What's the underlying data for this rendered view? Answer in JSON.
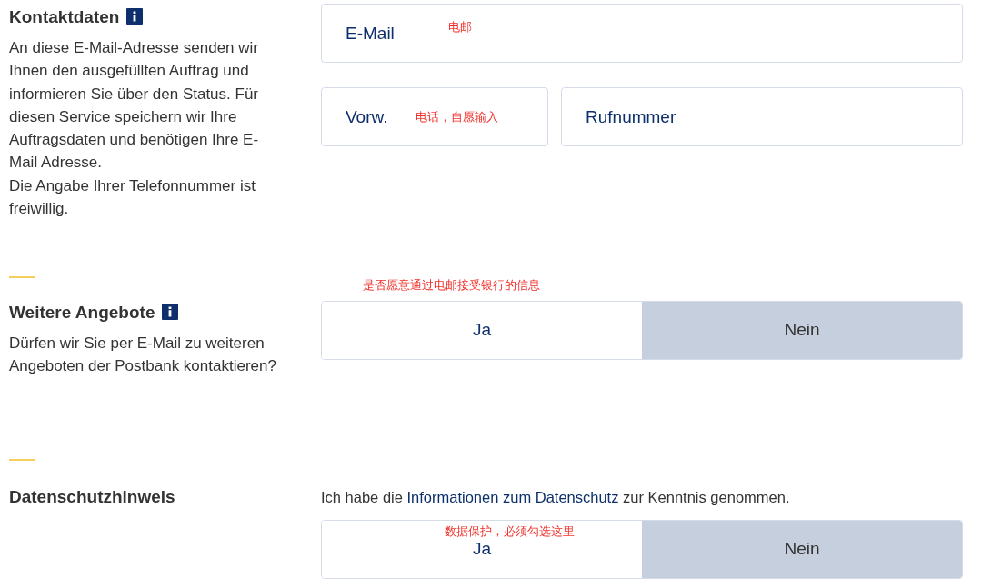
{
  "sections": [
    {
      "kind": "contact",
      "title": "Kontaktdaten",
      "info": true,
      "description": [
        "An diese E-Mail-Adresse senden wir Ihnen den ausgefüllten Auftrag und informieren Sie über den Status. Für diesen Service speichern wir Ihre Auftragsdaten und benötigen Ihre E-Mail Adresse.",
        "Die Angabe Ihrer Telefonnummer ist freiwillig."
      ],
      "email": {
        "placeholder": "E-Mail",
        "annotation": "电邮"
      },
      "area_code": {
        "placeholder": "Vorw.",
        "annotation": "电话，自愿输入"
      },
      "phone": {
        "placeholder": "Rufnummer"
      }
    },
    {
      "kind": "choice",
      "title": "Weitere Angebote",
      "info": true,
      "description": [
        "Dürfen wir Sie per E-Mail zu weiteren Angeboten der Postbank kontaktieren?"
      ],
      "annotation": "是否愿意通过电邮接受银行的信息",
      "options": [
        {
          "label": "Ja",
          "selected": false
        },
        {
          "label": "Nein",
          "selected": true
        }
      ]
    },
    {
      "kind": "choice",
      "title": "Datenschutzhinweis",
      "info": false,
      "notice": {
        "before": "Ich habe die",
        "link": "Informationen zum Datenschutz",
        "after": "zur Kenntnis genommen."
      },
      "annotation": "数据保护，必须勾选这里",
      "options": [
        {
          "label": "Ja",
          "selected": false
        },
        {
          "label": "Nein",
          "selected": true
        }
      ]
    }
  ]
}
